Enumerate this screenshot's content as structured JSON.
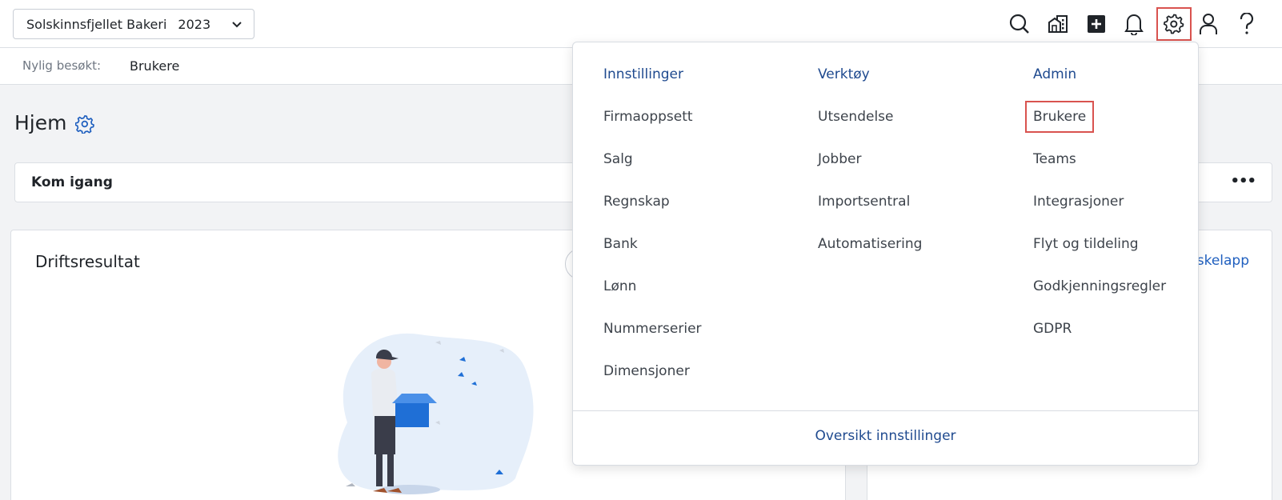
{
  "topbar": {
    "company": "Solskinnsfjellet Bakeri",
    "year": "2023",
    "icons": [
      "search-icon",
      "company-icon",
      "add-icon",
      "bell-icon",
      "gear-icon",
      "user-icon",
      "help-icon"
    ]
  },
  "recent": {
    "label": "Nylig besøkt:",
    "items": [
      "Brukere"
    ]
  },
  "page": {
    "title": "Hjem",
    "kom_igang": "Kom igang",
    "more": "•••",
    "driftsresultat": "Driftsresultat",
    "right_card_link": "skelapp"
  },
  "menu": {
    "columns": [
      {
        "heading": "Innstillinger",
        "items": [
          "Firmaoppsett",
          "Salg",
          "Regnskap",
          "Bank",
          "Lønn",
          "Nummerserier",
          "Dimensjoner"
        ]
      },
      {
        "heading": "Verktøy",
        "items": [
          "Utsendelse",
          "Jobber",
          "Importsentral",
          "Automatisering"
        ]
      },
      {
        "heading": "Admin",
        "items": [
          "Brukere",
          "Teams",
          "Integrasjoner",
          "Flyt og tildeling",
          "Godkjenningsregler",
          "GDPR"
        ]
      }
    ],
    "highlighted_item": "Brukere",
    "footer": "Oversikt innstillinger"
  },
  "colors": {
    "accent": "#1f4a8f",
    "highlight_border": "#d9534f",
    "link": "#1f5fbf"
  }
}
